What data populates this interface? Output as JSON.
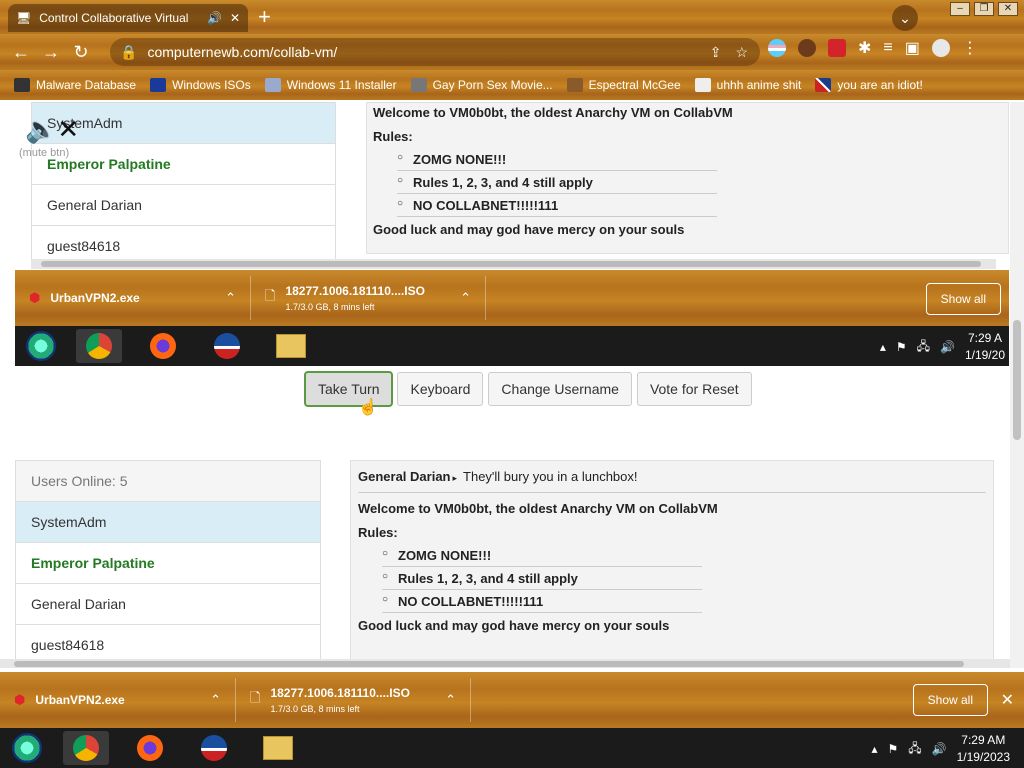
{
  "browser": {
    "tab_title": "Control Collaborative Virtual",
    "url": "computernewb.com/collab-vm/",
    "bookmarks": [
      {
        "label": "Malware Database"
      },
      {
        "label": "Windows ISOs"
      },
      {
        "label": "Windows 11 Installer"
      },
      {
        "label": "Gay Porn Sex Movie..."
      },
      {
        "label": "Espectral McGee"
      },
      {
        "label": "uhhh anime shit"
      },
      {
        "label": "you are an idiot!"
      }
    ]
  },
  "vm_view": {
    "mute_label": "(mute btn)",
    "users": [
      "SystemAdm",
      "Emperor Palpatine",
      "General Darian",
      "guest84618"
    ],
    "chat": {
      "welcome": "Welcome to VM0b0bt, the oldest Anarchy VM on CollabVM",
      "rules_label": "Rules:",
      "rules": [
        "ZOMG NONE!!!",
        "Rules 1, 2, 3, and 4 still apply",
        "NO COLLABNET!!!!!111"
      ],
      "goodbye": "Good luck and may god have mercy on your souls"
    },
    "downloads": [
      {
        "name": "UrbanVPN2.exe"
      },
      {
        "name": "18277.1006.181110....ISO",
        "status": "1.7/3.0 GB, 8 mins left"
      }
    ],
    "show_all": "Show all",
    "clock_time": "7:29 A",
    "clock_date": "1/19/20"
  },
  "controls": {
    "take_turn": "Take Turn",
    "keyboard": "Keyboard",
    "change_username": "Change Username",
    "vote_reset": "Vote for Reset"
  },
  "users_panel": {
    "header": "Users Online: 5",
    "users": [
      "SystemAdm",
      "Emperor Palpatine",
      "General Darian",
      "guest84618"
    ]
  },
  "chat_panel": {
    "last_sender": "General Darian",
    "last_message": "They'll bury you in a lunchbox!",
    "welcome": "Welcome to VM0b0bt, the oldest Anarchy VM on CollabVM",
    "rules_label": "Rules:",
    "rules": [
      "ZOMG NONE!!!",
      "Rules 1, 2, 3, and 4 still apply",
      "NO COLLABNET!!!!!111"
    ],
    "goodbye": "Good luck and may god have mercy on your souls"
  },
  "download_bar": {
    "items": [
      {
        "name": "UrbanVPN2.exe"
      },
      {
        "name": "18277.1006.181110....ISO",
        "status": "1.7/3.0 GB, 8 mins left"
      }
    ],
    "show_all": "Show all"
  },
  "taskbar": {
    "clock_time": "7:29 AM",
    "clock_date": "1/19/2023"
  }
}
